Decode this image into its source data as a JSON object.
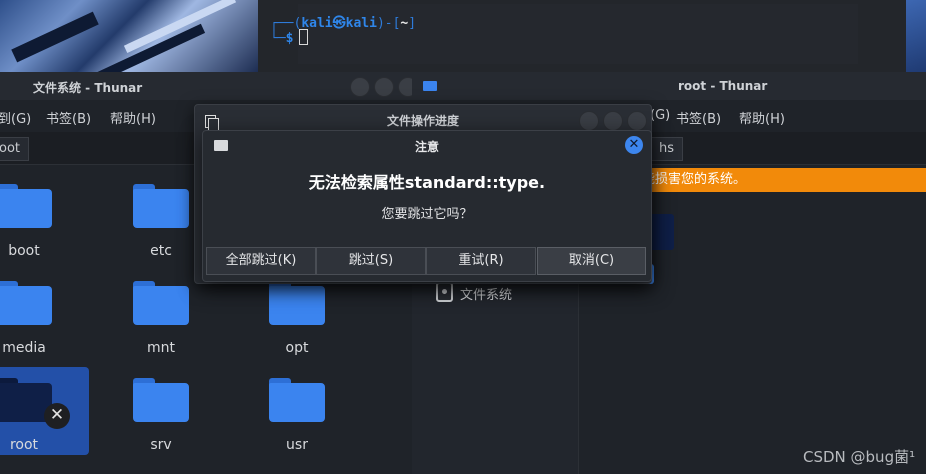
{
  "terminal": {
    "prompt_open": "┌──(",
    "user_host": "kali㉿kali",
    "prompt_mid": ")-[",
    "path": "~",
    "prompt_close": "]",
    "line2_corner": "└─",
    "dollar": "$"
  },
  "left_window": {
    "title": "文件系统 - Thunar",
    "menu": [
      "到(G)",
      "书签(B)",
      "帮助(H)"
    ],
    "path_button": "oot",
    "folders": [
      "boot",
      "etc",
      "media",
      "mnt",
      "opt",
      "root",
      "srv",
      "usr"
    ]
  },
  "right_window": {
    "title": "root - Thunar",
    "menu": [
      "(G)",
      "书签(B)",
      "帮助(H)"
    ],
    "path_button": "hs",
    "warning": "能损害您的系统。",
    "side_item": "文件系统"
  },
  "progress_dialog": {
    "title": "文件操作进度"
  },
  "alert_dialog": {
    "title": "注意",
    "message": "无法检索属性standard::type.",
    "question": "您要跳过它吗？",
    "buttons": [
      "全部跳过(K)",
      "跳过(S)",
      "重试(R)",
      "取消(C)"
    ],
    "close_glyph": "✕"
  },
  "watermark": "CSDN @bug菌¹",
  "colors": {
    "accent": "#3d86ee",
    "folder": "#3b84ef",
    "warning": "#f28a0a",
    "terminal_blue": "#2f86ea"
  }
}
